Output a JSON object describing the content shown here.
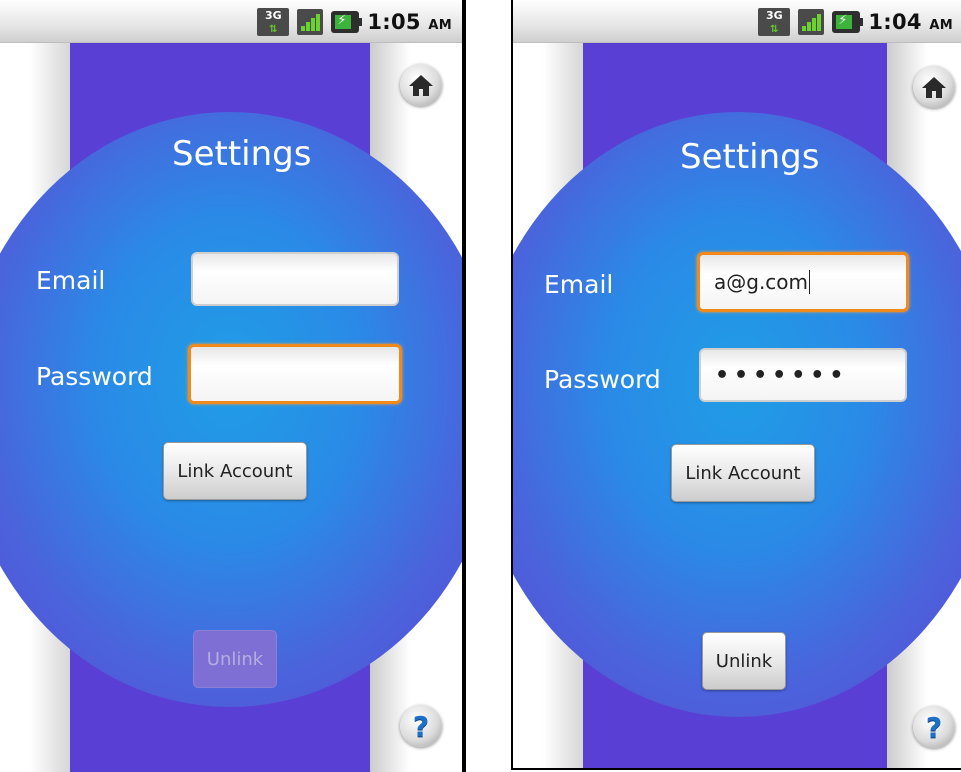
{
  "screens": [
    {
      "status": {
        "clock": "1:05",
        "ampm": "AM",
        "network": "3G"
      },
      "title": "Settings",
      "email_label": "Email",
      "password_label": "Password",
      "email_value": "",
      "password_value": "",
      "link_button": "Link Account",
      "unlink_button": "Unlink",
      "focused_field": "password",
      "unlink_enabled": false
    },
    {
      "status": {
        "clock": "1:04",
        "ampm": "AM",
        "network": "3G"
      },
      "title": "Settings",
      "email_label": "Email",
      "password_label": "Password",
      "email_value": "a@g.com",
      "password_value": "•••••••",
      "link_button": "Link Account",
      "unlink_button": "Unlink",
      "focused_field": "email",
      "unlink_enabled": true
    }
  ],
  "colors": {
    "accent_focus": "#f08a1c",
    "stripe": "#5a3fd4",
    "oval_center": "#1f9de6",
    "oval_edge": "#5a48d4"
  },
  "icons": [
    "home-icon",
    "help-icon",
    "signal-3g-icon",
    "signal-bars-icon",
    "battery-icon"
  ]
}
